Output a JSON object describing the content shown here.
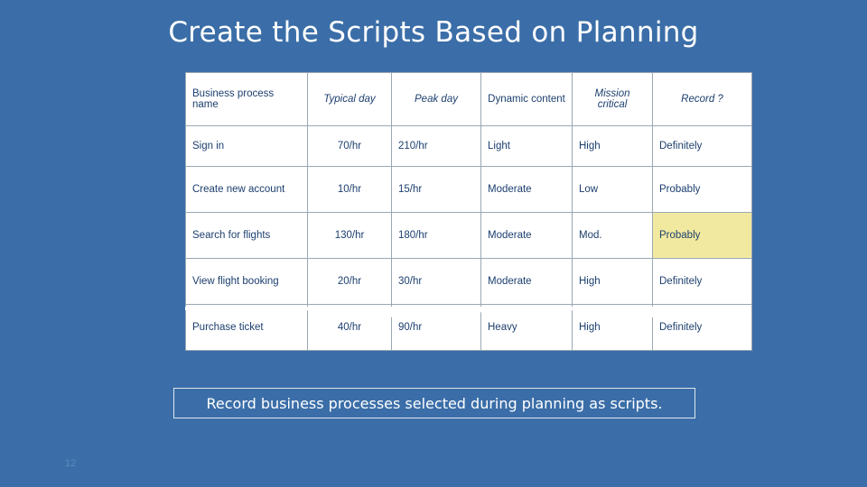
{
  "slide": {
    "title": "Create the Scripts Based on Planning",
    "page_number": "12",
    "callout": "Record business processes selected during planning as scripts."
  },
  "table": {
    "headers": [
      "Business process name",
      "Typical day",
      "Peak day",
      "Dynamic content",
      "Mission critical",
      "Record ?"
    ],
    "rows": [
      {
        "name": "Sign in",
        "typical_day": "70/hr",
        "peak_day": "210/hr",
        "dynamic_content": "Light",
        "mission_critical": "High",
        "record": "Definitely",
        "highlight": false
      },
      {
        "name": "Create new account",
        "typical_day": "10/hr",
        "peak_day": "15/hr",
        "dynamic_content": "Moderate",
        "mission_critical": "Low",
        "record": "Probably",
        "highlight": false
      },
      {
        "name": "Search for flights",
        "typical_day": "130/hr",
        "peak_day": "180/hr",
        "dynamic_content": "Moderate",
        "mission_critical": "Mod.",
        "record": "Probably",
        "highlight": true
      },
      {
        "name": "View flight booking",
        "typical_day": "20/hr",
        "peak_day": "30/hr",
        "dynamic_content": "Moderate",
        "mission_critical": "High",
        "record": "Definitely",
        "highlight": false
      },
      {
        "name": "Purchase ticket",
        "typical_day": "40/hr",
        "peak_day": "90/hr",
        "dynamic_content": "Heavy",
        "mission_critical": "High",
        "record": "Definitely",
        "highlight": false
      }
    ]
  },
  "colors": {
    "background": "#3b6ea8",
    "text_dark": "#1f4e79",
    "highlight": "#f2e9a0",
    "callout_border": "#dfe7ef"
  }
}
